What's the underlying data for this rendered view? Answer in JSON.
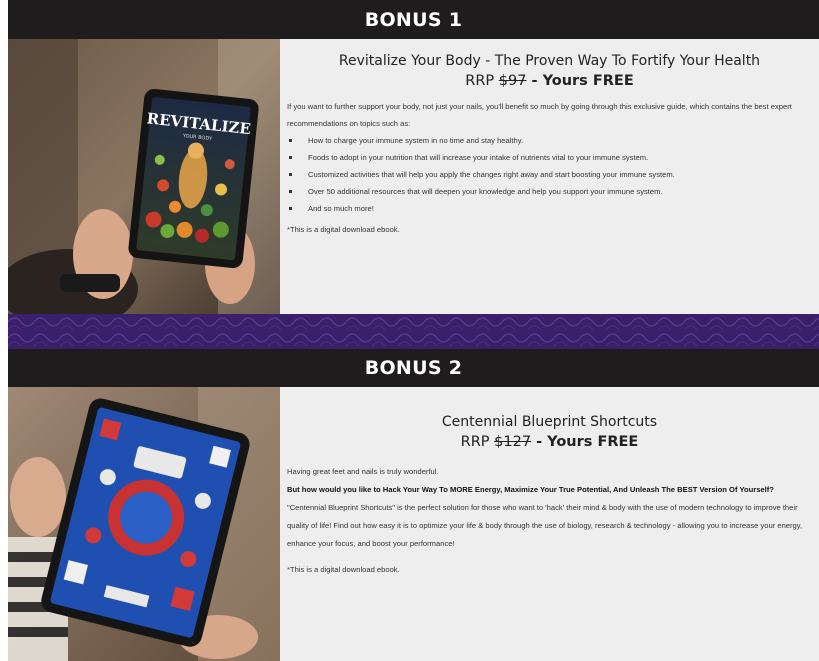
{
  "bonus1": {
    "header": "BONUS 1",
    "book_title": "REVITALIZE",
    "book_subtitle": "YOUR BODY",
    "title": "Revitalize Your Body - The Proven Way To Fortify Your Health",
    "rrp_prefix": "RRP ",
    "rrp_price": "$97",
    "rrp_suffix": " - Yours FREE",
    "intro": "If you want to further support your body, not just your nails, you'll benefit so much by going through this exclusive guide, which contains the best expert recommendations on topics such as:",
    "bullets": [
      "How to charge your immune system in no time and stay healthy.",
      "Foods to adopt in your nutrition that will increase your intake of nutrients vital to your immune system.",
      "Customized activities that will help you apply the changes right away and start boosting your immune system.",
      "Over 50 additional resources that will deepen your knowledge and help you support your immune system.",
      "And so much more!"
    ],
    "note": "*This is a digital download ebook."
  },
  "bonus2": {
    "header": "BONUS 2",
    "title": "Centennial Blueprint Shortcuts",
    "rrp_prefix": "RRP ",
    "rrp_price": "$127",
    "rrp_suffix": " - Yours FREE",
    "line1": "Having great feet and nails is truly wonderful.",
    "bold_line": "But how would you like to Hack Your Way To MORE Energy, Maximize Your True Potential, And Unleash The BEST Version Of Yourself?",
    "para": "\"Centennial Blueprint Shortcuts\" is the perfect solution for those who want to 'hack' their mind & body with the use of modern technology to improve their quality of life! Find out how easy it is to optimize your life & body through the use of biology, research & technology - allowing you to increase your energy, enhance your focus, and boost your performance!",
    "note": "*This is a digital download ebook."
  },
  "colors": {
    "header_bg": "#1e1c1d",
    "panel_bg": "#eeeeee",
    "divider": "#3a1f6a"
  }
}
